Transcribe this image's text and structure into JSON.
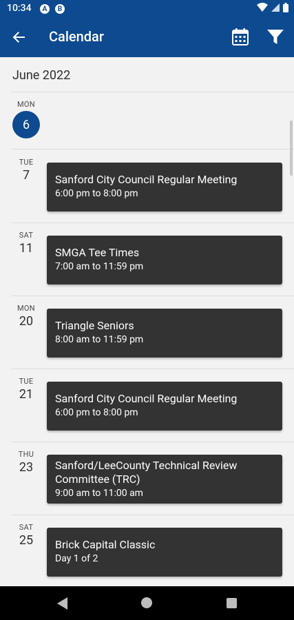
{
  "status_bar": {
    "time": "10:34",
    "notif_a": "A",
    "notif_b": "B"
  },
  "app_bar": {
    "title": "Calendar",
    "back_icon": "arrow-left-icon",
    "calendar_icon": "calendar-icon",
    "filter_icon": "filter-icon"
  },
  "month": "June 2022",
  "today": {
    "dow": "MON",
    "day": "6"
  },
  "events": [
    {
      "dow": "TUE",
      "day": "7",
      "title": "Sanford City Council Regular Meeting",
      "time": "6:00 pm to 8:00 pm"
    },
    {
      "dow": "SAT",
      "day": "11",
      "title": "SMGA Tee Times",
      "time": "7:00 am to 11:59 pm"
    },
    {
      "dow": "MON",
      "day": "20",
      "title": "Triangle Seniors",
      "time": "8:00 am to 11:59 pm"
    },
    {
      "dow": "TUE",
      "day": "21",
      "title": "Sanford City Council Regular Meeting",
      "time": "6:00 pm to 8:00 pm"
    },
    {
      "dow": "THU",
      "day": "23",
      "title_line1": "Sanford/LeeCounty Technical Review",
      "title_line2": "Committee (TRC)",
      "time": "9:00 am to 11:00 am"
    },
    {
      "dow": "SAT",
      "day": "25",
      "title": "Brick Capital Classic",
      "time": "Day 1 of 2"
    }
  ],
  "colors": {
    "primary": "#0d4a8f",
    "card": "#333333",
    "background": "#f2f2f2"
  }
}
